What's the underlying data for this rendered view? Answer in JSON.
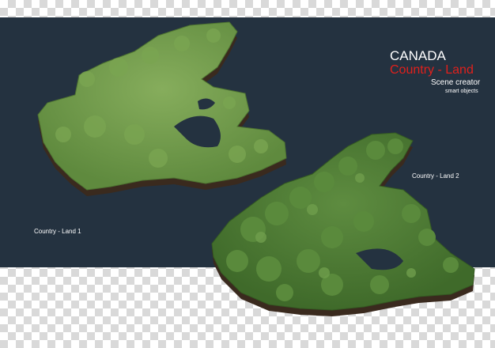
{
  "header": {
    "title": "CANADA",
    "subtitle": "Country - Land",
    "line3": "Scene creator",
    "line4": "smart objects"
  },
  "captions": {
    "land1": "Country - Land 1",
    "land2": "Country - Land 2"
  },
  "colors": {
    "panel": "#243240",
    "subtitle": "#e0201c",
    "grass": "#6e9a4a",
    "trees": "#4e7e36",
    "soil": "#3a2a1e"
  },
  "icons": {
    "land1": "canada-grass-map",
    "land2": "canada-forest-map"
  }
}
